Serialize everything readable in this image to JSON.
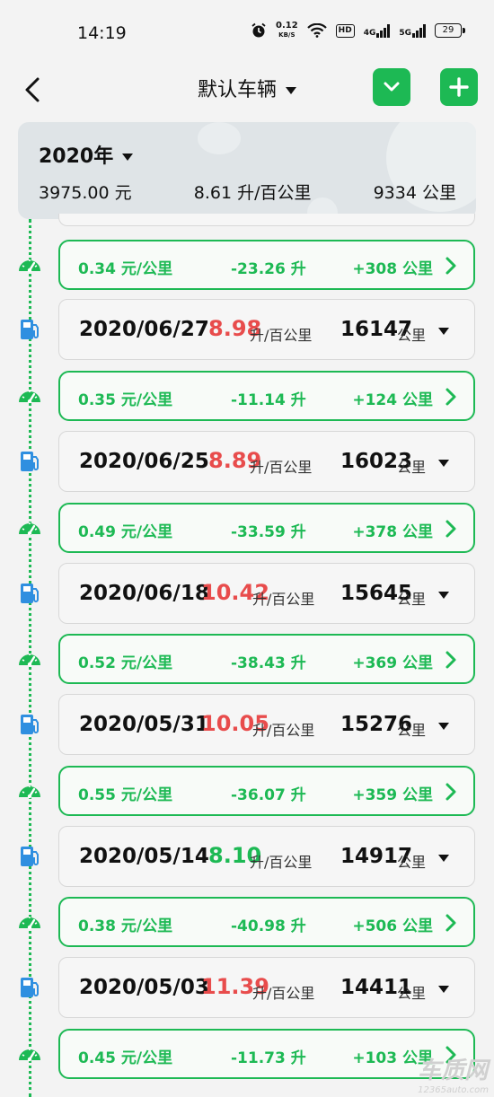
{
  "status": {
    "time": "14:19",
    "speed_top": "0.12",
    "speed_unit": "KB/S",
    "hd": "HD",
    "net1": "4G",
    "net2": "5G",
    "battery": "29"
  },
  "header": {
    "title": "默认车辆"
  },
  "summary": {
    "year": "2020年",
    "cost": "3975.00 元",
    "consumption": "8.61 升/百公里",
    "distance": "9334 公里"
  },
  "trips": [
    {
      "cost": "0.34 元/公里",
      "fuel": "-23.26 升",
      "dist": "+308 公里"
    },
    {
      "cost": "0.35 元/公里",
      "fuel": "-11.14 升",
      "dist": "+124 公里"
    },
    {
      "cost": "0.49 元/公里",
      "fuel": "-33.59 升",
      "dist": "+378 公里"
    },
    {
      "cost": "0.52 元/公里",
      "fuel": "-38.43 升",
      "dist": "+369 公里"
    },
    {
      "cost": "0.55 元/公里",
      "fuel": "-36.07 升",
      "dist": "+359 公里"
    },
    {
      "cost": "0.38 元/公里",
      "fuel": "-40.98 升",
      "dist": "+506 公里"
    },
    {
      "cost": "0.45 元/公里",
      "fuel": "-11.73 升",
      "dist": "+103 公里"
    }
  ],
  "refuels": [
    {
      "date": "2020/06/27",
      "eff": "8.98",
      "eff_unit": "升/百公里",
      "odo": "16147",
      "odo_unit": "公里",
      "eff_color": "red"
    },
    {
      "date": "2020/06/25",
      "eff": "8.89",
      "eff_unit": "升/百公里",
      "odo": "16023",
      "odo_unit": "公里",
      "eff_color": "red"
    },
    {
      "date": "2020/06/18",
      "eff": "10.42",
      "eff_unit": "升/百公里",
      "odo": "15645",
      "odo_unit": "公里",
      "eff_color": "red"
    },
    {
      "date": "2020/05/31",
      "eff": "10.05",
      "eff_unit": "升/百公里",
      "odo": "15276",
      "odo_unit": "公里",
      "eff_color": "red"
    },
    {
      "date": "2020/05/14",
      "eff": "8.10",
      "eff_unit": "升/百公里",
      "odo": "14917",
      "odo_unit": "公里",
      "eff_color": "green"
    },
    {
      "date": "2020/05/03",
      "eff": "11.39",
      "eff_unit": "升/百公里",
      "odo": "14411",
      "odo_unit": "公里",
      "eff_color": "red"
    }
  ],
  "colors": {
    "accent": "#1db954",
    "high": "#e84c4c",
    "fuel_icon": "#2f8fe0"
  },
  "watermark": {
    "brand": "车质网",
    "url": "12365auto.com"
  }
}
